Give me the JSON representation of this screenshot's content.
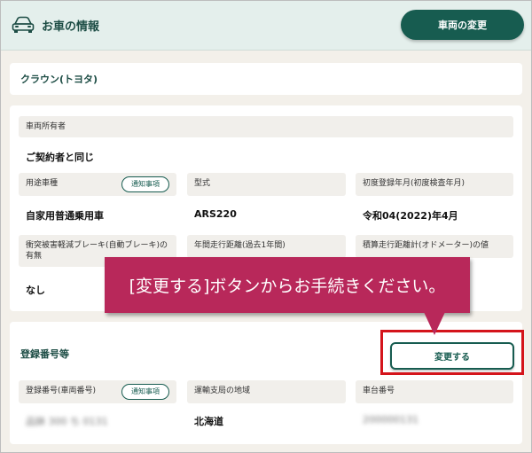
{
  "header": {
    "title": "お車の情報",
    "change_vehicle_label": "車両の変更"
  },
  "vehicle": {
    "model": "クラウン(トヨタ)"
  },
  "owner": {
    "label": "車両所有者",
    "value": "ご契約者と同じ"
  },
  "fields": {
    "usage_label": "用途車種",
    "usage_value": "自家用普通乗用車",
    "notice_label": "通知事項",
    "type_label": "型式",
    "type_value": "ARS220",
    "first_reg_label": "初度登録年月(初度検査年月)",
    "first_reg_value": "令和04(2022)年4月",
    "aeb_label": "衝突被害軽減ブレーキ(自動ブレーキ)の有無",
    "aeb_value": "なし",
    "annual_distance_label": "年間走行距離(過去1年間)",
    "odometer_label": "積算走行距離計(オドメーター)の値"
  },
  "registration": {
    "section_title": "登録番号等",
    "change_label": "変更する",
    "number_label": "登録番号(車両番号)",
    "notice_label": "通知事項",
    "number_value": "品鉢 300 ち 0131",
    "office_label": "運輸支局の地域",
    "office_value": "北海道",
    "chassis_label": "車台番号",
    "chassis_value": "200000131"
  },
  "callout": {
    "text": "[変更する]ボタンからお手続きください。"
  },
  "colors": {
    "brand_green": "#175c50",
    "header_bg": "#e4efec",
    "callout_bg": "#b8285a",
    "highlight_red": "#d4141b"
  }
}
